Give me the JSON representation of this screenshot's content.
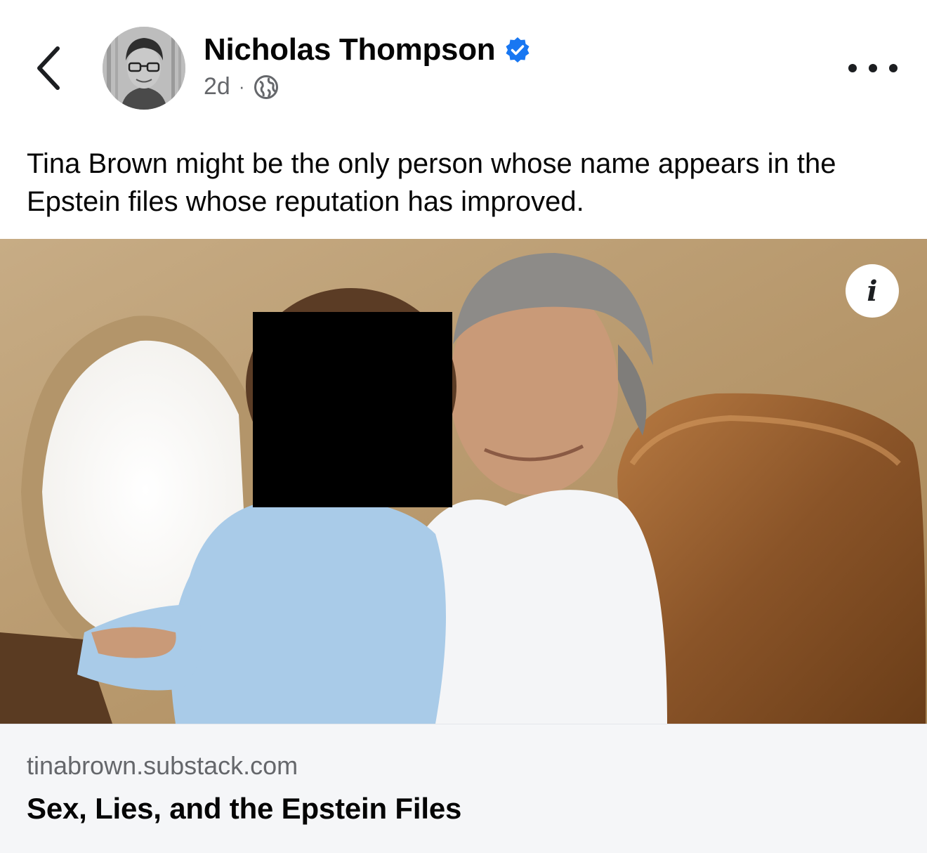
{
  "header": {
    "back_icon": "chevron-left-icon",
    "author_name": "Nicholas Thompson",
    "verified_icon": "verified-badge-icon",
    "timestamp": "2d",
    "separator": "·",
    "audience_icon": "globe-icon",
    "more_icon": "more-horizontal-icon"
  },
  "post": {
    "text": "Tina Brown might be the only person whose name appears in the Epstein files whose reputation has improved."
  },
  "photo": {
    "info_label": "i",
    "info_icon": "info-icon"
  },
  "link_preview": {
    "domain": "tinabrown.substack.com",
    "title": "Sex, Lies, and the Epstein Files"
  },
  "colors": {
    "verified_blue": "#1877f2",
    "text_primary": "#050505",
    "text_secondary": "#65676b",
    "preview_bg": "#f5f6f8"
  }
}
